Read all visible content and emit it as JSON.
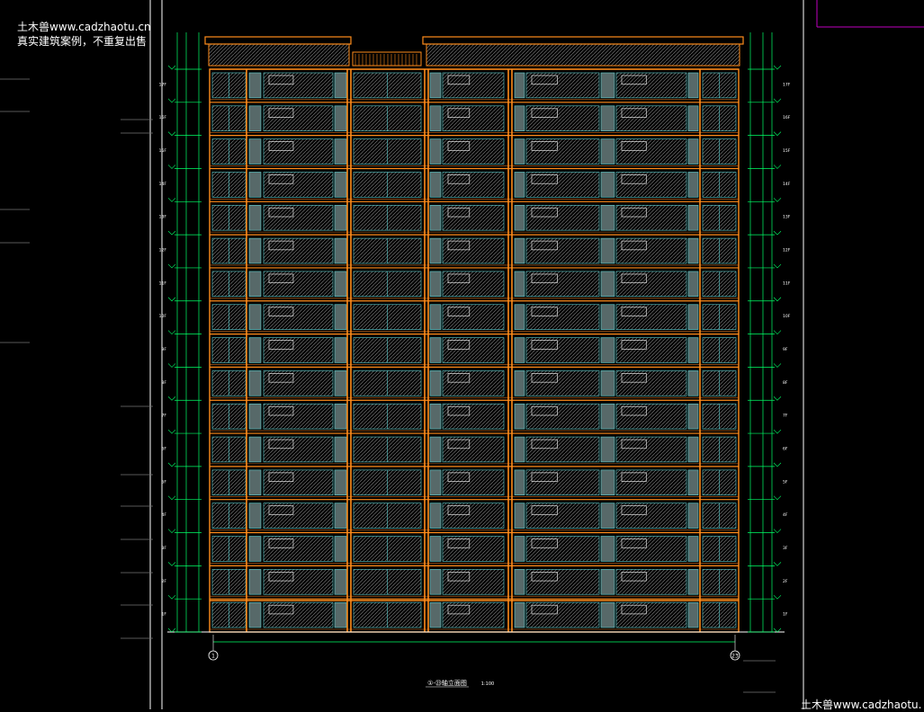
{
  "watermark": {
    "line1": "土木兽www.cadzhaotu.cn",
    "line2": "真实建筑案例，不重复出售",
    "bottom": "土木兽www.cadzhaotu."
  },
  "drawing": {
    "caption": "①-㉓轴立面图",
    "scale": "1:100",
    "axis_start": "1",
    "axis_end": "23",
    "floors": 17,
    "floor_labels": [
      "1F",
      "2F",
      "3F",
      "4F",
      "5F",
      "6F",
      "7F",
      "8F",
      "9F",
      "10F",
      "11F",
      "12F",
      "13F",
      "14F",
      "15F",
      "16F",
      "17F"
    ],
    "colors": {
      "background": "#000000",
      "outline": "#ff8c1a",
      "window": "#5fd3d3",
      "hatch": "#9a9a9a",
      "panel": "#9fbfbf",
      "dimension": "#00ff66",
      "frame": "#ffffff",
      "magenta": "#c000c0"
    }
  }
}
